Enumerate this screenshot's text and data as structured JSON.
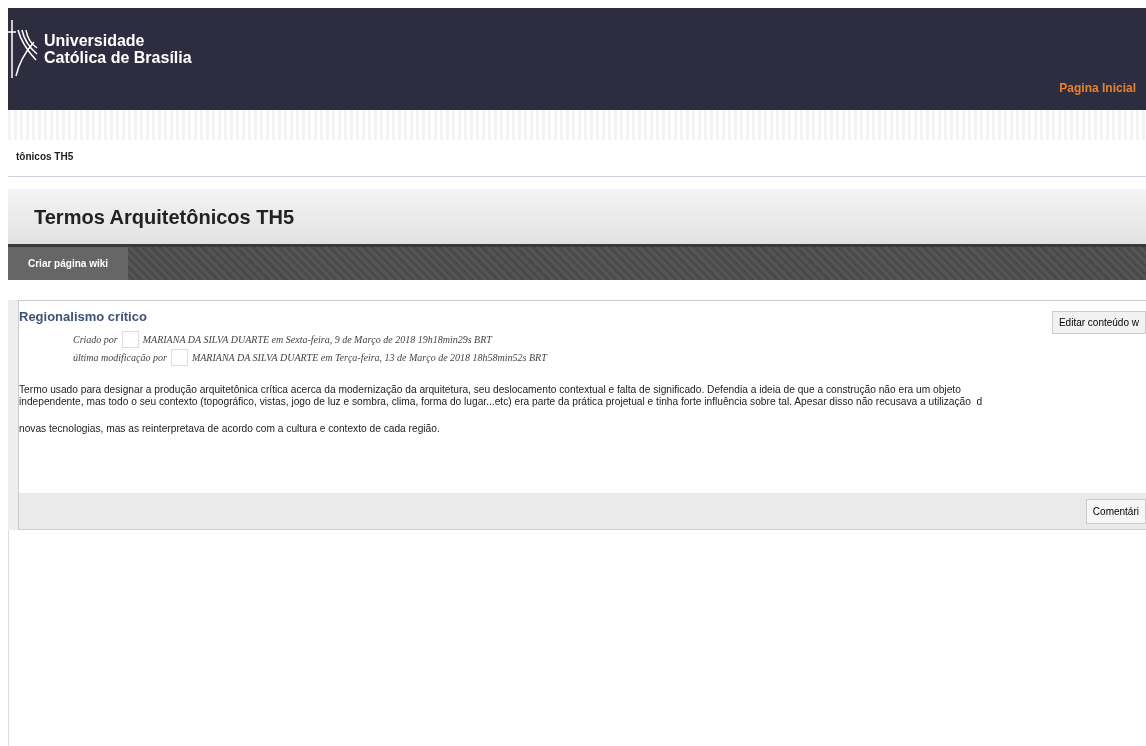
{
  "header": {
    "logo_lines": [
      "Universidade",
      "Católica de Brasília"
    ],
    "nav_link": "Pagina Inicial"
  },
  "breadcrumb": "tônicos TH5",
  "page_title": "Termos Arquitetônicos TH5",
  "tabs": [
    {
      "label": "Criar página wiki",
      "selected": true
    }
  ],
  "wiki_page": {
    "title": "Regionalismo crítico",
    "edit_button": "Editar conteúdo w",
    "meta": [
      {
        "label": "Criado por",
        "text": "MARIANA DA SILVA DUARTE em Sexta-feira, 9 de Março de 2018 19h18min29s BRT"
      },
      {
        "label": "última modificação por",
        "text": "MARIANA DA SILVA DUARTE em Terça-feira, 13 de Março de 2018 18h58min52s BRT"
      }
    ],
    "body_lines": [
      "Termo usado para designar a produção arquitetônica crítica acerca da modernização da arquitetura, seu deslocamento contextual e falta de significado. Defendia a ideia de que a construção não era um objeto",
      "independente, mas todo o seu contexto (topográfico, vistas, jogo de luz e sombra, clima, forma do lugar...etc) era parte da prática projetual e tinha forte influência sobre tal. Apesar disso não recusava a utilização  d"
    ],
    "body_paragraph2": "novas tecnologias, mas as reinterpretava de acordo com a cultura e contexto de cada região.",
    "comments_button": "Comentári"
  }
}
